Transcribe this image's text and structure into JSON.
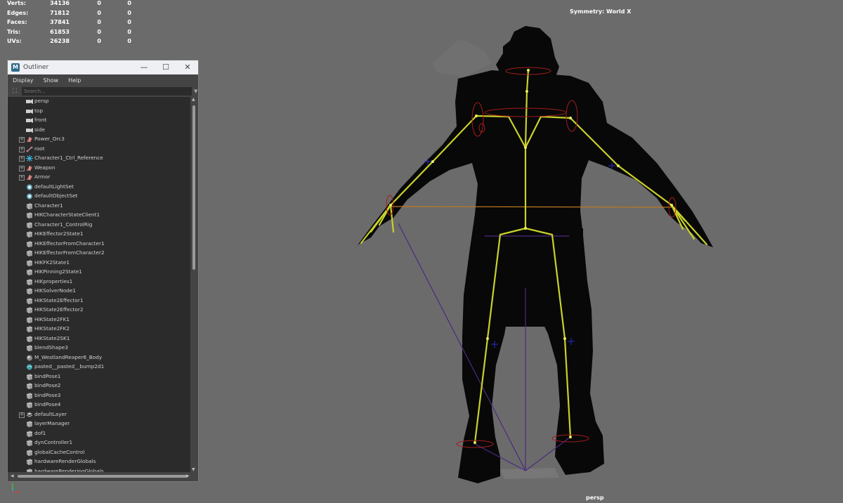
{
  "hud": {
    "stats": [
      {
        "label": "Verts:",
        "v1": "34136",
        "v2": "0",
        "v3": "0"
      },
      {
        "label": "Edges:",
        "v1": "71812",
        "v2": "0",
        "v3": "0"
      },
      {
        "label": "Faces:",
        "v1": "37841",
        "v2": "0",
        "v3": "0"
      },
      {
        "label": "Tris:",
        "v1": "61853",
        "v2": "0",
        "v3": "0"
      },
      {
        "label": "UVs:",
        "v1": "26238",
        "v2": "0",
        "v3": "0"
      }
    ],
    "symmetry": "Symmetry: World X",
    "camera": "persp"
  },
  "outliner": {
    "title": "Outliner",
    "logo": "M",
    "window_buttons": {
      "minimize": "—",
      "maximize": "☐",
      "close": "✕"
    },
    "menu": [
      "Display",
      "Show",
      "Help"
    ],
    "search": {
      "placeholder": "Search...",
      "value": ""
    },
    "items": [
      {
        "label": "persp",
        "icon": "camera-icon",
        "expandable": false
      },
      {
        "label": "top",
        "icon": "camera-icon",
        "expandable": false
      },
      {
        "label": "front",
        "icon": "camera-icon",
        "expandable": false
      },
      {
        "label": "side",
        "icon": "camera-icon",
        "expandable": false
      },
      {
        "label": "Power_Orc3",
        "icon": "mesh-icon",
        "expandable": true
      },
      {
        "label": "root",
        "icon": "joint-icon",
        "expandable": true
      },
      {
        "label": "Character1_Ctrl_Reference",
        "icon": "hik-reference-icon",
        "expandable": true
      },
      {
        "label": "Weapon",
        "icon": "mesh-icon",
        "expandable": true
      },
      {
        "label": "Armor",
        "icon": "mesh-icon",
        "expandable": true
      },
      {
        "label": "defaultLightSet",
        "icon": "set-icon",
        "expandable": false
      },
      {
        "label": "defaultObjectSet",
        "icon": "set-icon",
        "expandable": false
      },
      {
        "label": "Character1",
        "icon": "node-icon",
        "expandable": false
      },
      {
        "label": "HIKCharacterStateClient1",
        "icon": "node-icon",
        "expandable": false
      },
      {
        "label": "Character1_ControlRig",
        "icon": "node-icon",
        "expandable": false
      },
      {
        "label": "HIKEffector2State1",
        "icon": "node-icon",
        "expandable": false
      },
      {
        "label": "HIKEffectorFromCharacter1",
        "icon": "node-icon",
        "expandable": false
      },
      {
        "label": "HIKEffectorFromCharacter2",
        "icon": "node-icon",
        "expandable": false
      },
      {
        "label": "HIKFK2State1",
        "icon": "node-icon",
        "expandable": false
      },
      {
        "label": "HIKPinning2State1",
        "icon": "node-icon",
        "expandable": false
      },
      {
        "label": "HIKproperties1",
        "icon": "node-icon",
        "expandable": false
      },
      {
        "label": "HIKSolverNode1",
        "icon": "node-icon",
        "expandable": false
      },
      {
        "label": "HIKState2Effector1",
        "icon": "node-icon",
        "expandable": false
      },
      {
        "label": "HIKState2Effector2",
        "icon": "node-icon",
        "expandable": false
      },
      {
        "label": "HIKState2FK1",
        "icon": "node-icon",
        "expandable": false
      },
      {
        "label": "HIKState2FK2",
        "icon": "node-icon",
        "expandable": false
      },
      {
        "label": "HIKState2SK1",
        "icon": "node-icon",
        "expandable": false
      },
      {
        "label": "blendShape3",
        "icon": "node-icon",
        "expandable": false
      },
      {
        "label": "M_WestlandReaper6_Body",
        "icon": "material-icon",
        "expandable": false
      },
      {
        "label": "pasted__pasted__bump2d1",
        "icon": "bump-icon",
        "expandable": false
      },
      {
        "label": "bindPose1",
        "icon": "node-icon",
        "expandable": false
      },
      {
        "label": "bindPose2",
        "icon": "node-icon",
        "expandable": false
      },
      {
        "label": "bindPose3",
        "icon": "node-icon",
        "expandable": false
      },
      {
        "label": "bindPose4",
        "icon": "node-icon",
        "expandable": false
      },
      {
        "label": "defaultLayer",
        "icon": "layer-icon",
        "expandable": true
      },
      {
        "label": "layerManager",
        "icon": "node-icon",
        "expandable": false
      },
      {
        "label": "dof1",
        "icon": "node-icon",
        "expandable": false
      },
      {
        "label": "dynController1",
        "icon": "node-icon",
        "expandable": false
      },
      {
        "label": "globalCacheControl",
        "icon": "node-icon",
        "expandable": false
      },
      {
        "label": "hardwareRenderGlobals",
        "icon": "node-icon",
        "expandable": false
      },
      {
        "label": "hardwareRenderingGlobals",
        "icon": "node-icon",
        "expandable": false
      }
    ]
  },
  "colors": {
    "viewport_bg": "#6b6b6b",
    "silhouette": "#080808",
    "bone": "#c9d12a",
    "joint_ring": "#a51c1c",
    "ik_line": "#4b2a80",
    "cross_line": "#c07a20"
  }
}
